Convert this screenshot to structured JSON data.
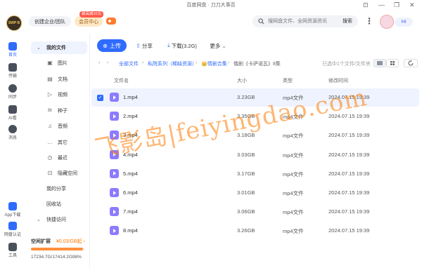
{
  "window": {
    "title": "百度网盘 · 刀刀大事否",
    "minimize": "—",
    "restore": "❐",
    "close": "✕",
    "pin": "⊡"
  },
  "header": {
    "logo_text": "SWP B",
    "create_btn": "创建企业/团队",
    "vip_btn": "会员中心",
    "vip_badge": "最高减10元",
    "search_placeholder": "搜网盘文件、全网资源资讯",
    "search_btn": "搜索",
    "more": "⋮",
    "hi": "Hi"
  },
  "rail": {
    "items": [
      {
        "label": "首页",
        "icon": "home-icon"
      },
      {
        "label": "传输",
        "icon": "transfer-icon"
      },
      {
        "label": "同步",
        "icon": "sync-icon"
      },
      {
        "label": "AI看",
        "icon": "ai-icon"
      },
      {
        "label": "消息",
        "icon": "message-icon"
      },
      {
        "label": "App下载",
        "icon": "app-download-icon"
      },
      {
        "label": "网盘认证",
        "icon": "verify-icon"
      },
      {
        "label": "工具",
        "icon": "tools-icon"
      }
    ]
  },
  "nav": {
    "my_files": "我的文件",
    "items": [
      {
        "label": "图片",
        "icon": "▣"
      },
      {
        "label": "文档",
        "icon": "▤"
      },
      {
        "label": "视频",
        "icon": "▷"
      },
      {
        "label": "种子",
        "icon": "Bt"
      },
      {
        "label": "音频",
        "icon": "♫"
      },
      {
        "label": "其它",
        "icon": "…"
      },
      {
        "label": "最近",
        "icon": "◷"
      },
      {
        "label": "隐藏空间",
        "icon": "⊡"
      }
    ],
    "share": "我的分享",
    "recycle": "回收站",
    "quick": "快捷访问",
    "quick_arrow": "⌄"
  },
  "space": {
    "title": "空间扩容",
    "price": "¥0.03/GB起 ›",
    "used": "17234.7G/17414.2G98%",
    "used_fraction": 0.98
  },
  "toolbar": {
    "upload": "上传",
    "share": "分享",
    "download": "下载(3.2G)",
    "more": "更多",
    "upload_icon": "⊕",
    "share_icon": "⇪",
    "download_icon": "⤓",
    "more_icon": "⌄"
  },
  "breadcrumb": {
    "back": "‹",
    "forward": "›",
    "sep": "›",
    "items": [
      "全部文件",
      "私院系列（稀缺资源）",
      "👑情剧合集",
      "俄剧《卡萨诺瓦》8集"
    ],
    "status": "已选中1个文件/文件夹"
  },
  "columns": {
    "name": "文件名",
    "size": "大小",
    "type": "类型",
    "time": "修改时间"
  },
  "files": [
    {
      "name": "1.mp4",
      "size": "3.23GB",
      "type": "mp4文件",
      "time": "2024.07.15 19:39",
      "selected": true
    },
    {
      "name": "2.mp4",
      "size": "3.35GB",
      "type": "mp4文件",
      "time": "2024.07.15 19:39",
      "selected": false
    },
    {
      "name": "3.mp4",
      "size": "3.18GB",
      "type": "mp4文件",
      "time": "2024.07.15 19:39",
      "selected": false
    },
    {
      "name": "4.mp4",
      "size": "3.03GB",
      "type": "mp4文件",
      "time": "2024.07.15 19:39",
      "selected": false
    },
    {
      "name": "5.mp4",
      "size": "3.17GB",
      "type": "mp4文件",
      "time": "2024.07.15 19:39",
      "selected": false
    },
    {
      "name": "6.mp4",
      "size": "3.01GB",
      "type": "mp4文件",
      "time": "2024.07.15 19:39",
      "selected": false
    },
    {
      "name": "7.mp4",
      "size": "3.06GB",
      "type": "mp4文件",
      "time": "2024.07.15 19:39",
      "selected": false
    },
    {
      "name": "8.mp4",
      "size": "3.26GB",
      "type": "mp4文件",
      "time": "2024.07.15 19:39",
      "selected": false
    }
  ],
  "watermark": "飞影岛|feiyingdao.com",
  "colors": {
    "accent": "#2f6bff",
    "video": "#8c7bff",
    "watermark": "#ff7a00"
  }
}
